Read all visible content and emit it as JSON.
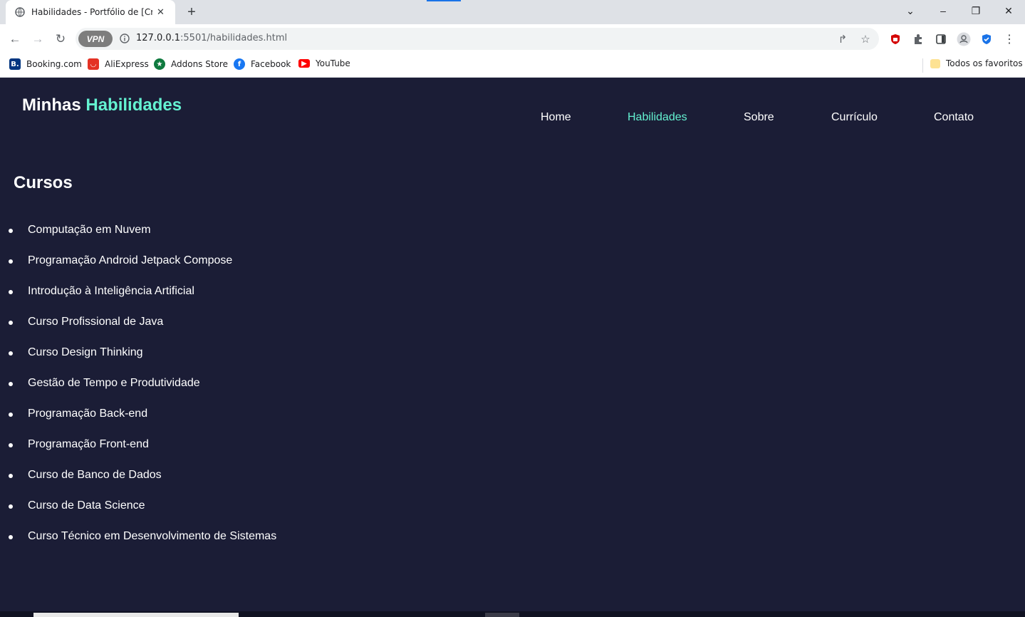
{
  "browser": {
    "tab_title": "Habilidades - Portfólio de [Cristi",
    "url_host": "127.0.0.1",
    "url_rest": ":5501/habilidades.html",
    "vpn_label": "VPN",
    "icons": [
      "back-icon",
      "forward-icon",
      "reload-icon",
      "info-icon",
      "share-icon",
      "star-icon",
      "extension-icon",
      "puzzle-icon",
      "sidepanel-icon",
      "profile-icon",
      "shield-icon",
      "menu-icon"
    ],
    "bookmarks": [
      {
        "label": "Booking.com",
        "color": "#003580"
      },
      {
        "label": "AliExpress",
        "color": "#e43225"
      },
      {
        "label": "Addons Store",
        "color": "#0f7a3f"
      },
      {
        "label": "Facebook",
        "color": "#1877f2"
      },
      {
        "label": "YouTube",
        "color": "#ff0000"
      }
    ],
    "all_bookmarks": "Todos os favoritos"
  },
  "site": {
    "brand_prefix": "Minhas",
    "brand_accent": "Habilidades",
    "accent_color": "#64f2d1",
    "background": "#1b1d36",
    "nav": [
      "Home",
      "Habilidades",
      "Sobre",
      "Currículo",
      "Contato"
    ],
    "active_nav": "Habilidades"
  },
  "courses": {
    "title": "Cursos",
    "items": [
      "Computação em Nuvem",
      "Programação Android Jetpack Compose",
      "Introdução à Inteligência Artificial",
      "Curso Profissional de Java",
      "Curso Design Thinking",
      "Gestão de Tempo e Produtividade",
      "Programação Back-end",
      "Programação Front-end",
      "Curso de Banco de Dados",
      "Curso de Data Science",
      "Curso Técnico em Desenvolvimento de Sistemas"
    ]
  }
}
